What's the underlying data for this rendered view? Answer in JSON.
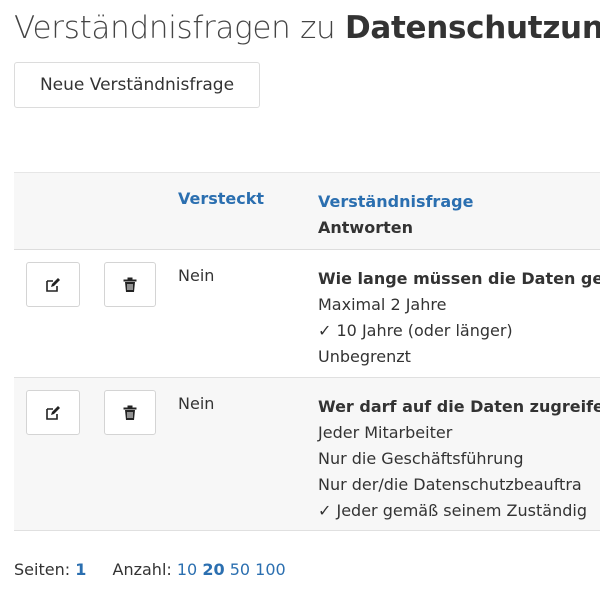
{
  "header": {
    "title_prefix": "Verständnisfragen zu ",
    "title_bold": "Datenschutzunt"
  },
  "toolbar": {
    "new_label": "Neue Verständnisfrage"
  },
  "table": {
    "col_hidden": "Versteckt",
    "col_question": "Verständnisfrage",
    "col_answers": "Antworten",
    "rows": [
      {
        "hidden": "Nein",
        "question": "Wie lange müssen die Daten ge",
        "answers": [
          "Maximal 2 Jahre",
          "✓ 10 Jahre (oder länger)",
          "Unbegrenzt"
        ]
      },
      {
        "hidden": "Nein",
        "question": "Wer darf auf die Daten zugreife",
        "answers": [
          "Jeder Mitarbeiter",
          "Nur die Geschäftsführung",
          "Nur der/die Datenschutzbeauftra",
          "✓ Jeder gemäß seinem Zuständig"
        ]
      }
    ]
  },
  "pager": {
    "pages_label": "Seiten:",
    "current_page": "1",
    "count_label": "Anzahl:",
    "sizes": [
      "10",
      "20",
      "50",
      "100"
    ],
    "selected_size": "20"
  },
  "icons": {
    "edit": "edit-icon",
    "delete": "trash-icon"
  },
  "colors": {
    "link": "#2b6fb0",
    "header_bg": "#f7f7f7"
  }
}
